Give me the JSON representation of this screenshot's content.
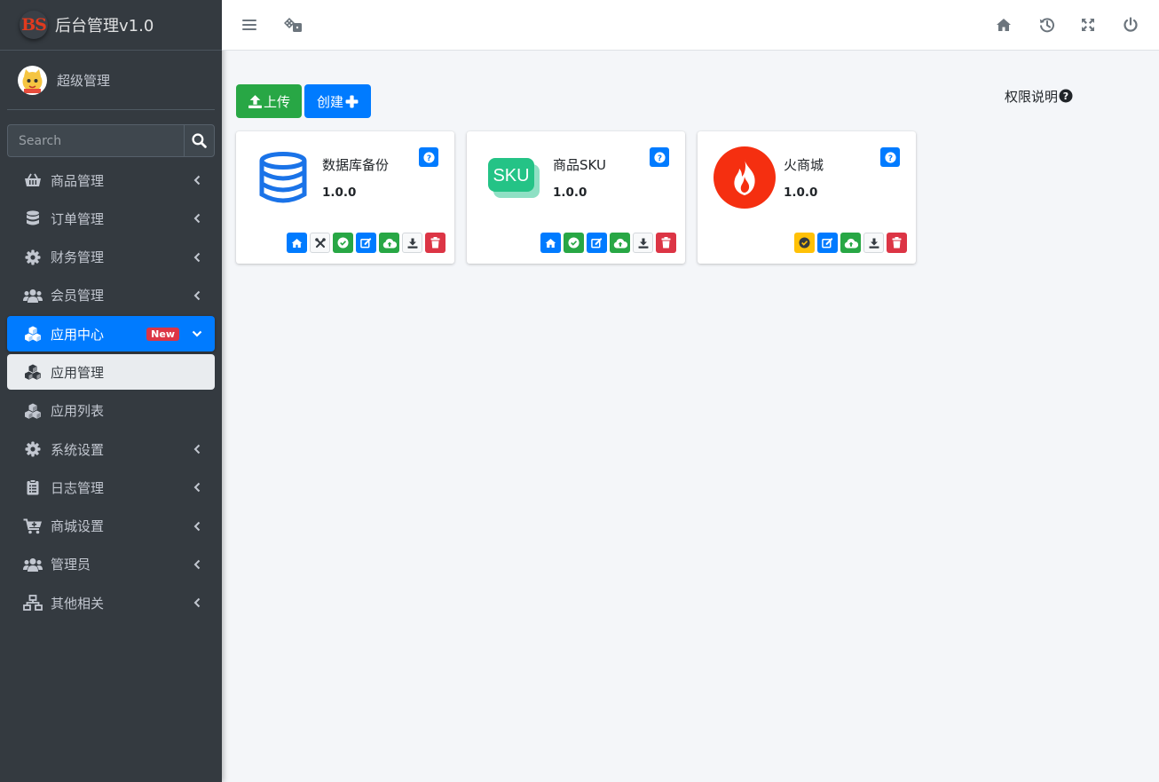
{
  "brand": {
    "logo_text": "BS",
    "title": "后台管理v1.0"
  },
  "user": {
    "name": "超级管理"
  },
  "search": {
    "placeholder": "Search"
  },
  "sidebar": {
    "items": [
      {
        "label": "商品管理",
        "icon": "basket-icon"
      },
      {
        "label": "订单管理",
        "icon": "database-icon"
      },
      {
        "label": "财务管理",
        "icon": "gear-icon"
      },
      {
        "label": "会员管理",
        "icon": "users-icon"
      },
      {
        "label": "应用中心",
        "icon": "cubes-icon",
        "badge": "New",
        "active": true
      },
      {
        "label": "应用管理",
        "icon": "cubes-icon"
      },
      {
        "label": "应用列表",
        "icon": "cubes-icon"
      },
      {
        "label": "系统设置",
        "icon": "gear-icon"
      },
      {
        "label": "日志管理",
        "icon": "clipboard-icon"
      },
      {
        "label": "商城设置",
        "icon": "cart-icon"
      },
      {
        "label": "管理员",
        "icon": "users-icon"
      },
      {
        "label": "其他相关",
        "icon": "sitemap-icon"
      }
    ]
  },
  "toolbar": {
    "upload_label": "上传",
    "create_label": "创建",
    "permission_label": "权限说明"
  },
  "apps": [
    {
      "title": "数据库备份",
      "version": "1.0.0",
      "logo": "database-logo"
    },
    {
      "title": "商品SKU",
      "version": "1.0.0",
      "logo": "sku-logo",
      "logo_text": "SKU"
    },
    {
      "title": "火商城",
      "version": "1.0.0",
      "logo": "fire-logo"
    }
  ],
  "colors": {
    "primary": "#007bff",
    "success": "#28a745",
    "danger": "#dc3545",
    "warning": "#ffc107",
    "sidebar": "#343a40"
  }
}
